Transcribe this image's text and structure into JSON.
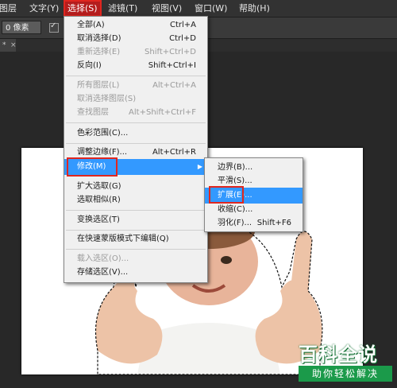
{
  "menubar": {
    "items": [
      {
        "label": "图层"
      },
      {
        "label": "文字(Y)"
      },
      {
        "label": "选择(S)"
      },
      {
        "label": "滤镜(T)"
      },
      {
        "label": "视图(V)"
      },
      {
        "label": "窗口(W)"
      },
      {
        "label": "帮助(H)"
      }
    ]
  },
  "options": {
    "feather_value": "0 像素"
  },
  "document_tab": {
    "label": "*",
    "close": "×"
  },
  "select_menu": {
    "items": [
      {
        "label": "全部(A)",
        "shortcut": "Ctrl+A"
      },
      {
        "label": "取消选择(D)",
        "shortcut": "Ctrl+D"
      },
      {
        "label": "重新选择(E)",
        "shortcut": "Shift+Ctrl+D"
      },
      {
        "label": "反向(I)",
        "shortcut": "Shift+Ctrl+I"
      },
      {
        "label": "所有图层(L)",
        "shortcut": "Alt+Ctrl+A"
      },
      {
        "label": "取消选择图层(S)",
        "shortcut": ""
      },
      {
        "label": "查找图层",
        "shortcut": "Alt+Shift+Ctrl+F"
      },
      {
        "label": "色彩范围(C)...",
        "shortcut": ""
      },
      {
        "label": "调整边缘(F)...",
        "shortcut": "Alt+Ctrl+R"
      },
      {
        "label": "修改(M)",
        "shortcut": ""
      },
      {
        "label": "扩大选取(G)",
        "shortcut": ""
      },
      {
        "label": "选取相似(R)",
        "shortcut": ""
      },
      {
        "label": "变换选区(T)",
        "shortcut": ""
      },
      {
        "label": "在快速蒙版模式下编辑(Q)",
        "shortcut": ""
      },
      {
        "label": "载入选区(O)...",
        "shortcut": ""
      },
      {
        "label": "存储选区(V)...",
        "shortcut": ""
      }
    ]
  },
  "modify_submenu": {
    "items": [
      {
        "label": "边界(B)...",
        "shortcut": ""
      },
      {
        "label": "平滑(S)...",
        "shortcut": ""
      },
      {
        "label": "扩展(E)...",
        "shortcut": ""
      },
      {
        "label": "收缩(C)...",
        "shortcut": ""
      },
      {
        "label": "羽化(F)...",
        "shortcut": "Shift+F6"
      }
    ]
  },
  "watermark": {
    "title": "百科全说",
    "subtitle": "助你轻松解决"
  },
  "colors": {
    "highlight": "#3399ff",
    "annotation_red": "#e0261f",
    "watermark_green": "#1b9a4a"
  }
}
